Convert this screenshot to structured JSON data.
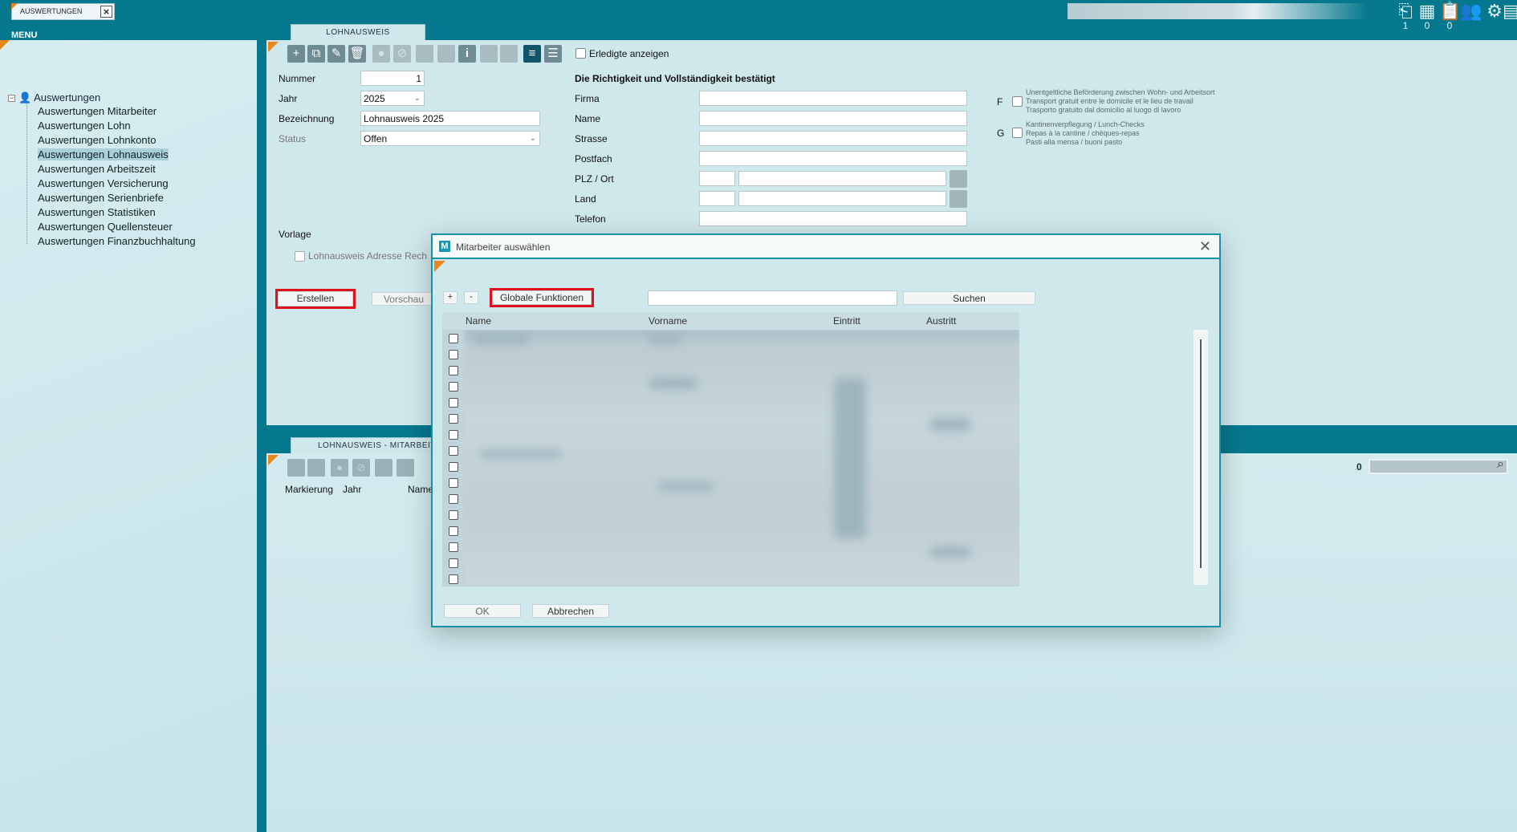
{
  "app_tab": {
    "label": "AUSWERTUNGEN",
    "close_icon": "close-icon"
  },
  "menu_label": "MENU",
  "top_icons": [
    {
      "icon": "tasks-icon",
      "count": "1"
    },
    {
      "icon": "calendar-icon",
      "count": "0"
    },
    {
      "icon": "clipboard-icon",
      "count": "0"
    },
    {
      "icon": "users-icon",
      "count": ""
    },
    {
      "icon": "gear-icon",
      "count": ""
    }
  ],
  "tree": {
    "root": "Auswertungen",
    "items": [
      "Auswertungen Mitarbeiter",
      "Auswertungen Lohn",
      "Auswertungen Lohnkonto",
      "Auswertungen Lohnausweis",
      "Auswertungen Arbeitszeit",
      "Auswertungen Versicherung",
      "Auswertungen Serienbriefe",
      "Auswertungen Statistiken",
      "Auswertungen Quellensteuer",
      "Auswertungen Finanzbuchhaltung"
    ],
    "selected_index": 3
  },
  "form": {
    "tab_label": "LOHNAUSWEIS",
    "show_done_label": "Erledigte anzeigen",
    "nummer_label": "Nummer",
    "nummer_value": "1",
    "jahr_label": "Jahr",
    "jahr_value": "2025",
    "bezeichnung_label": "Bezeichnung",
    "bezeichnung_value": "Lohnausweis 2025",
    "status_label": "Status",
    "status_value": "Offen",
    "vorlage_label": "Vorlage",
    "adresse_label": "Lohnausweis Adresse Rech",
    "create_button": "Erstellen",
    "preview_button": "Vorschau",
    "confirm_heading": "Die Richtigkeit und Vollständigkeit bestätigt",
    "firma_label": "Firma",
    "name_label": "Name",
    "strasse_label": "Strasse",
    "postfach_label": "Postfach",
    "plz_label": "PLZ / Ort",
    "land_label": "Land",
    "telefon_label": "Telefon",
    "f_letter": "F",
    "f_lines": [
      "Unentgeltliche Beförderung zwischen Wohn- und Arbeitsort",
      "Transport gratuit entre le domicile et le lieu de travail",
      "Trasporto gratuito dal domicilio al luogo di lavoro"
    ],
    "g_letter": "G",
    "g_lines": [
      "Kantinenverpflegung / Lunch-Checks",
      "Repas à la cantine / chèques-repas",
      "Pasti alla mensa / buoni pasto"
    ]
  },
  "lower": {
    "tab_label": "LOHNAUSWEIS - MITARBEITER",
    "col_markierung": "Markierung",
    "col_jahr": "Jahr",
    "col_name": "Name",
    "search_count": "0"
  },
  "modal": {
    "logo": "M",
    "title": "Mitarbeiter auswählen",
    "plus": "+",
    "minus": "-",
    "global_button": "Globale Funktionen",
    "search_button": "Suchen",
    "search_value": "",
    "columns": [
      "Name",
      "Vorname",
      "Eintritt",
      "Austritt"
    ],
    "row_count": 16,
    "ok_button": "OK",
    "cancel_button": "Abbrechen"
  }
}
